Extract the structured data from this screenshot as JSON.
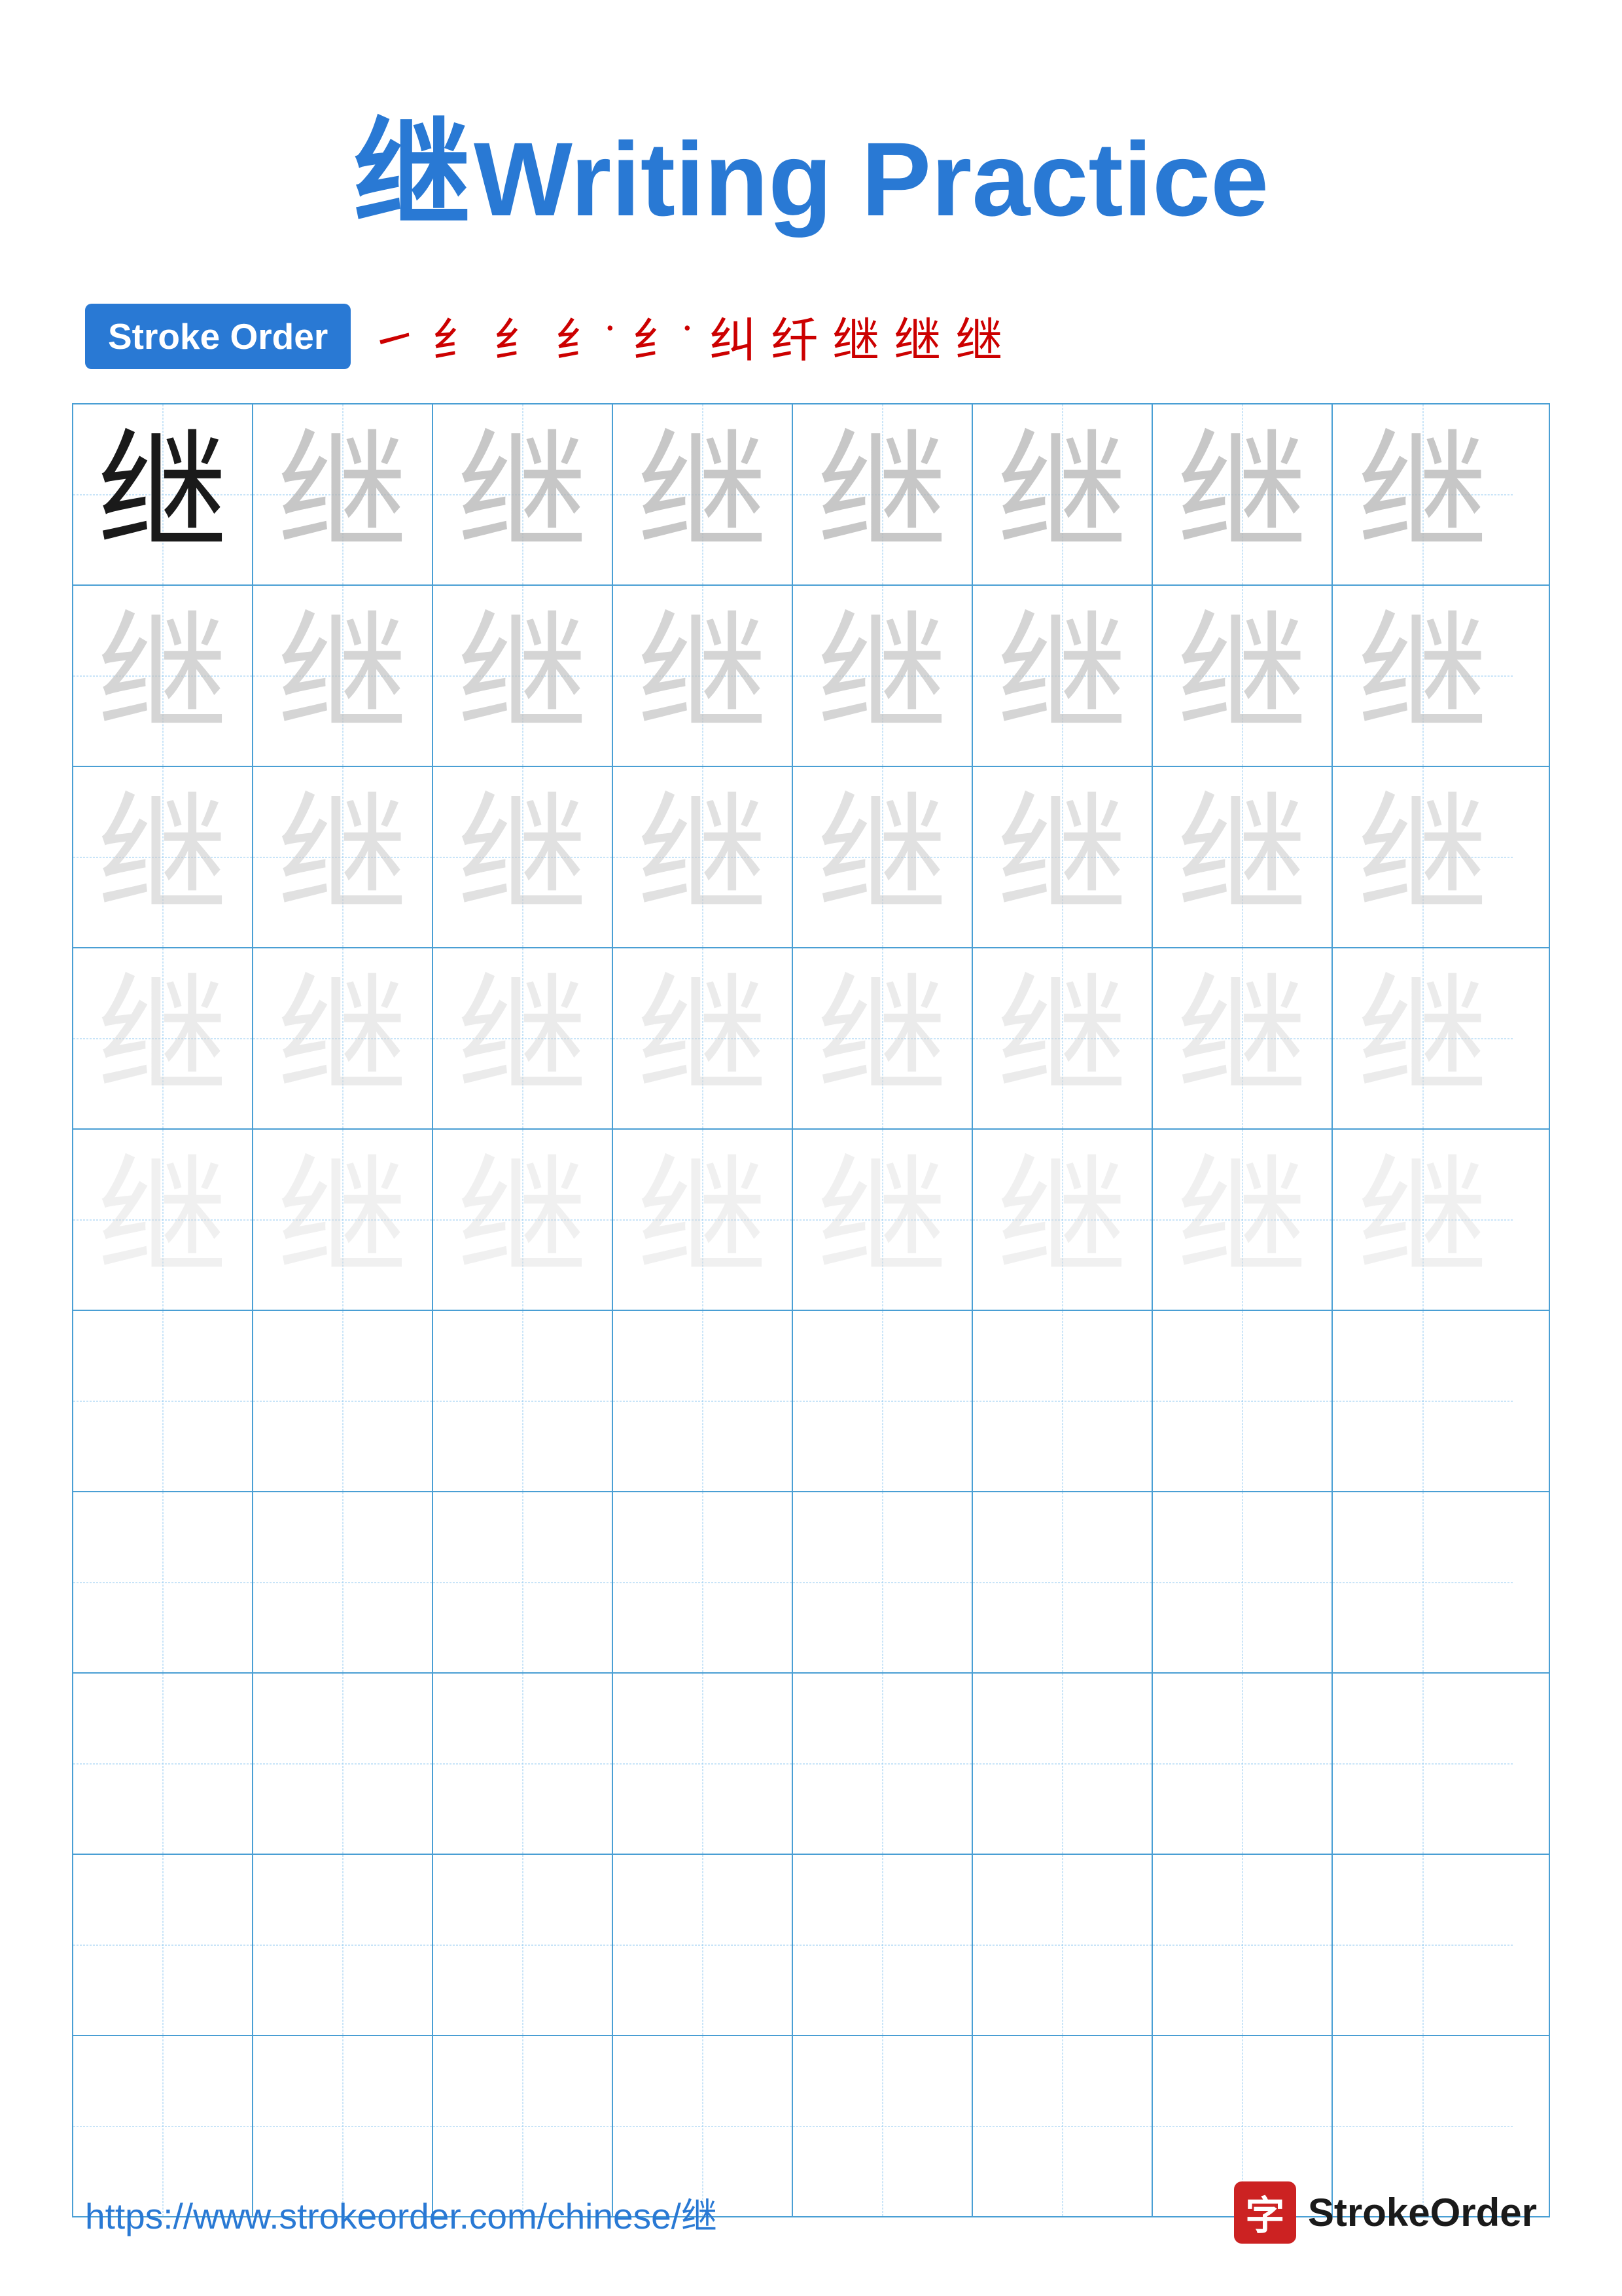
{
  "title": {
    "char": "继",
    "text": "Writing Practice"
  },
  "stroke_order": {
    "badge_label": "Stroke Order",
    "steps": [
      "㇀",
      "纟",
      "纟",
      "纟˙",
      "纟˙",
      "纠",
      "纤",
      "继",
      "继",
      "继"
    ]
  },
  "grid": {
    "rows": 10,
    "cols": 8,
    "char": "继",
    "guide_rows": [
      0,
      1,
      2,
      3,
      4
    ],
    "empty_rows": [
      5,
      6,
      7,
      8,
      9
    ]
  },
  "footer": {
    "url": "https://www.strokeorder.com/chinese/继",
    "logo_char": "字",
    "logo_name": "StrokeOrder"
  }
}
